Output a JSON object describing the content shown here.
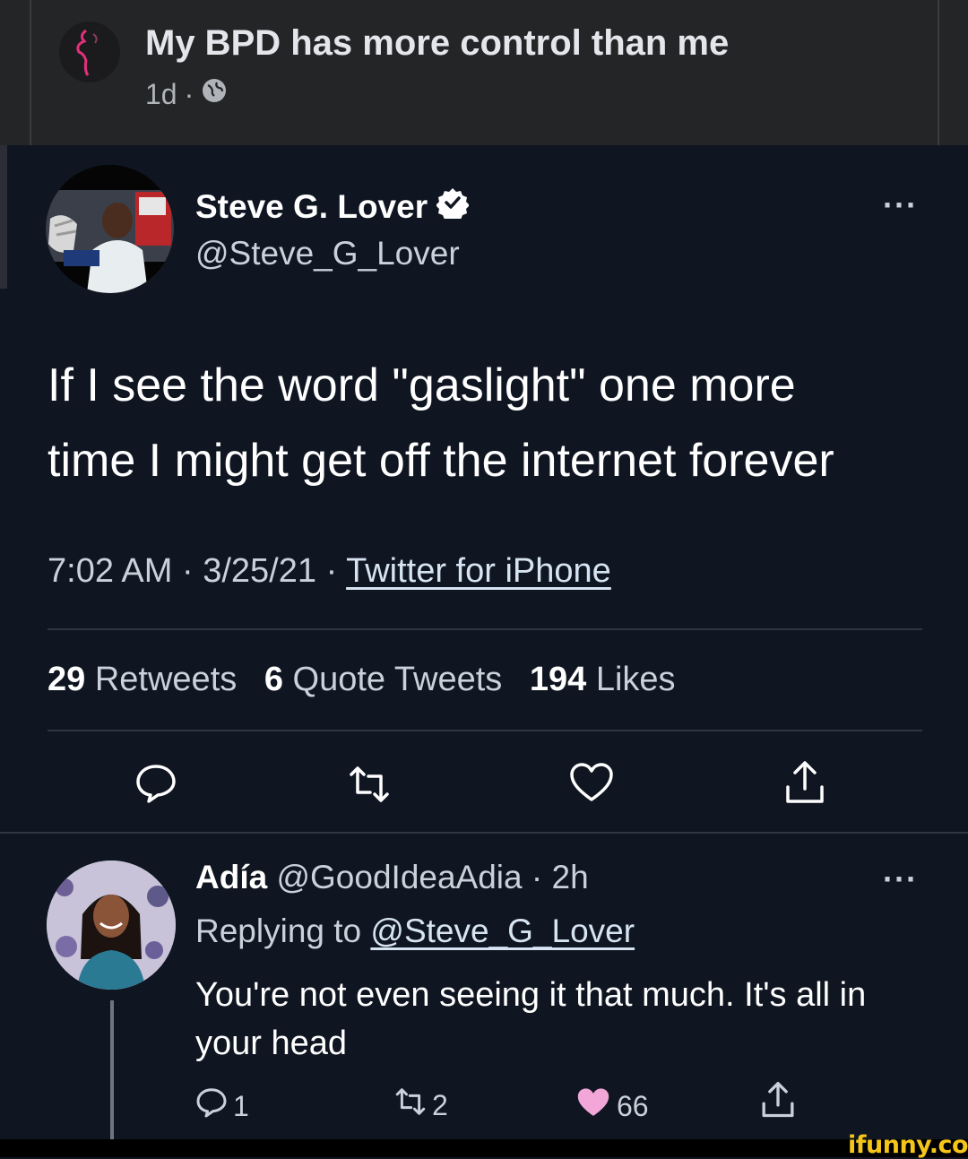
{
  "fb_post": {
    "group_name": "My BPD has more control than me",
    "time": "1d",
    "separator": "·",
    "privacy_icon": "globe-icon"
  },
  "tweet": {
    "author_name": "Steve G. Lover",
    "verified_icon": "verified-badge-icon",
    "handle": "@Steve_G_Lover",
    "more_icon": "···",
    "text_line1": "If I see the word \"gaslight\" one more",
    "text_line2": "time I might get off the internet forever",
    "time": "7:02 AM",
    "date": "3/25/21",
    "dot": "·",
    "source": "Twitter for iPhone",
    "stats": {
      "retweets_count": "29",
      "retweets_label": "Retweets",
      "quotes_count": "6",
      "quotes_label": "Quote Tweets",
      "likes_count": "194",
      "likes_label": "Likes"
    },
    "actions": [
      "reply-icon",
      "retweet-icon",
      "like-icon",
      "share-icon"
    ]
  },
  "reply": {
    "author_name": "Adía",
    "handle": "@GoodIdeaAdia",
    "dot": "·",
    "time": "2h",
    "more_icon": "···",
    "replying_label": "Replying to",
    "replying_handle": "@Steve_G_Lover",
    "text": "You're not even seeing it that much. It's all in your head",
    "reply_count": "1",
    "retweet_count": "2",
    "like_count": "66",
    "liked": true,
    "like_color": "#f2a7d8"
  },
  "watermark": "ifunny.co",
  "colors": {
    "background": "#0f1521",
    "header_background": "#242526",
    "watermark": "#f5c518"
  }
}
